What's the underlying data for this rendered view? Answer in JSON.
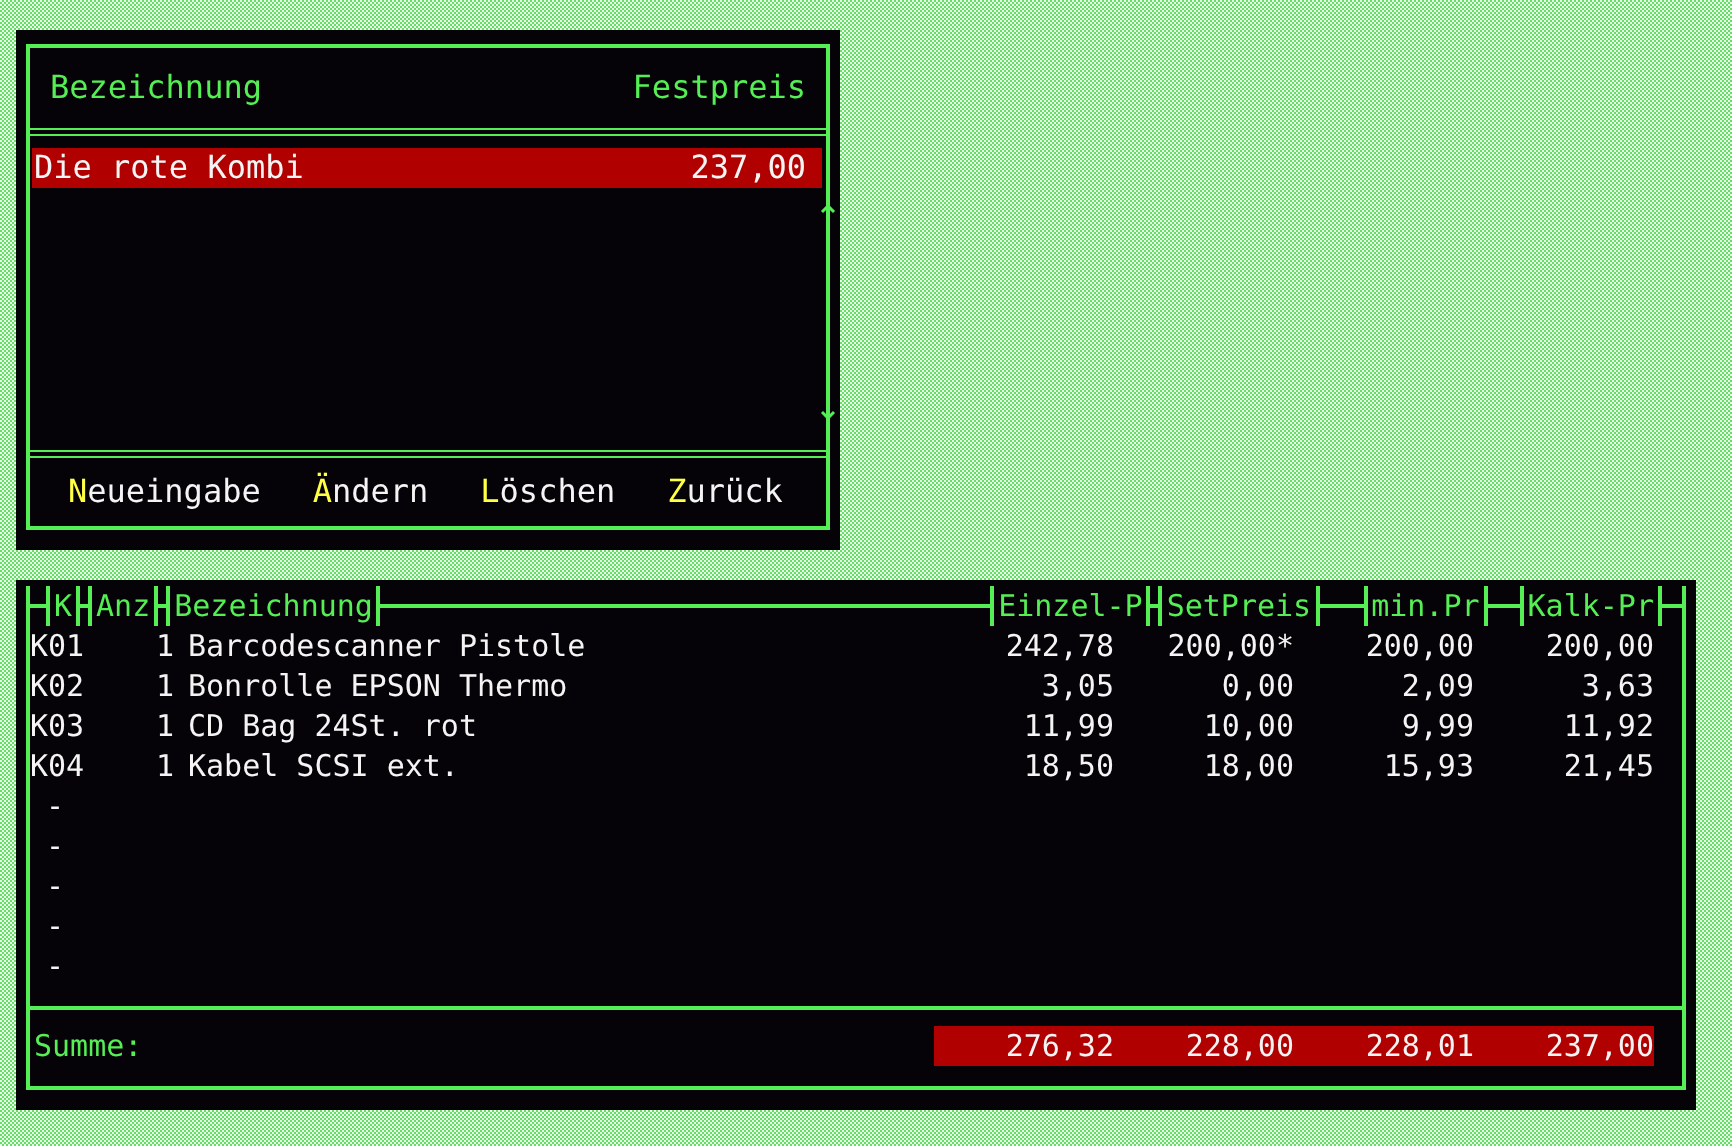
{
  "set_dialog": {
    "columns": [
      "Bezeichnung",
      "Festpreis"
    ],
    "items": [
      {
        "name": "Die rote Kombi",
        "price": "237,00",
        "selected": true
      }
    ],
    "buttons": [
      {
        "key": "N",
        "rest": "eueingabe"
      },
      {
        "key": "Ä",
        "rest": "ndern"
      },
      {
        "key": "L",
        "rest": "öschen"
      },
      {
        "key": "Z",
        "rest": "urück"
      }
    ]
  },
  "components": {
    "columns": [
      "K",
      "Anz",
      "Bezeichnung",
      "Einzel-P",
      "SetPreis",
      "min.Pr",
      "Kalk-Pr"
    ],
    "rows": [
      {
        "k": "K01",
        "anz": "1",
        "name": "Barcodescanner Pistole",
        "einzel": "242,78",
        "set": "200,00*",
        "min": "200,00",
        "kalk": "200,00"
      },
      {
        "k": "K02",
        "anz": "1",
        "name": "Bonrolle EPSON Thermo",
        "einzel": "3,05",
        "set": "0,00",
        "min": "2,09",
        "kalk": "3,63"
      },
      {
        "k": "K03",
        "anz": "1",
        "name": "CD Bag 24St. rot",
        "einzel": "11,99",
        "set": "10,00",
        "min": "9,99",
        "kalk": "11,92"
      },
      {
        "k": "K04",
        "anz": "1",
        "name": "Kabel SCSI ext.",
        "einzel": "18,50",
        "set": "18,00",
        "min": "15,93",
        "kalk": "21,45"
      }
    ],
    "empty_rows": [
      "-",
      "-",
      "-",
      "-",
      "-"
    ],
    "sum_label": "Summe:",
    "sums": [
      "276,32",
      "228,00",
      "228,01",
      "237,00"
    ]
  }
}
